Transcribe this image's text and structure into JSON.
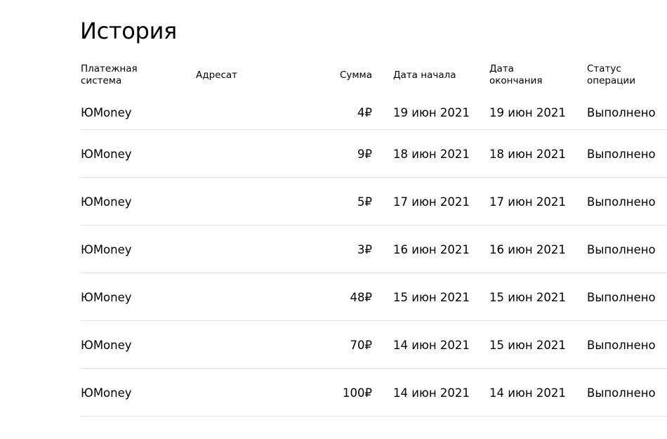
{
  "page": {
    "title": "История"
  },
  "table": {
    "headers": {
      "system": "Платежная система",
      "recipient": "Адресат",
      "amount": "Сумма",
      "start": "Дата начала",
      "end": "Дата окончания",
      "status": "Статус операции"
    },
    "rows": [
      {
        "system": "ЮMoney",
        "recipient": "",
        "amount": "4₽",
        "start": "19 июн 2021",
        "end": "19 июн 2021",
        "status": "Выполнено"
      },
      {
        "system": "ЮMoney",
        "recipient": "",
        "amount": "9₽",
        "start": "18 июн 2021",
        "end": "18 июн 2021",
        "status": "Выполнено"
      },
      {
        "system": "ЮMoney",
        "recipient": "",
        "amount": "5₽",
        "start": "17 июн 2021",
        "end": "17 июн 2021",
        "status": "Выполнено"
      },
      {
        "system": "ЮMoney",
        "recipient": "",
        "amount": "3₽",
        "start": "16 июн 2021",
        "end": "16 июн 2021",
        "status": "Выполнено"
      },
      {
        "system": "ЮMoney",
        "recipient": "",
        "amount": "48₽",
        "start": "15 июн 2021",
        "end": "15 июн 2021",
        "status": "Выполнено"
      },
      {
        "system": "ЮMoney",
        "recipient": "",
        "amount": "70₽",
        "start": "14 июн 2021",
        "end": "15 июн 2021",
        "status": "Выполнено"
      },
      {
        "system": "ЮMoney",
        "recipient": "",
        "amount": "100₽",
        "start": "14 июн 2021",
        "end": "14 июн 2021",
        "status": "Выполнено"
      }
    ]
  }
}
